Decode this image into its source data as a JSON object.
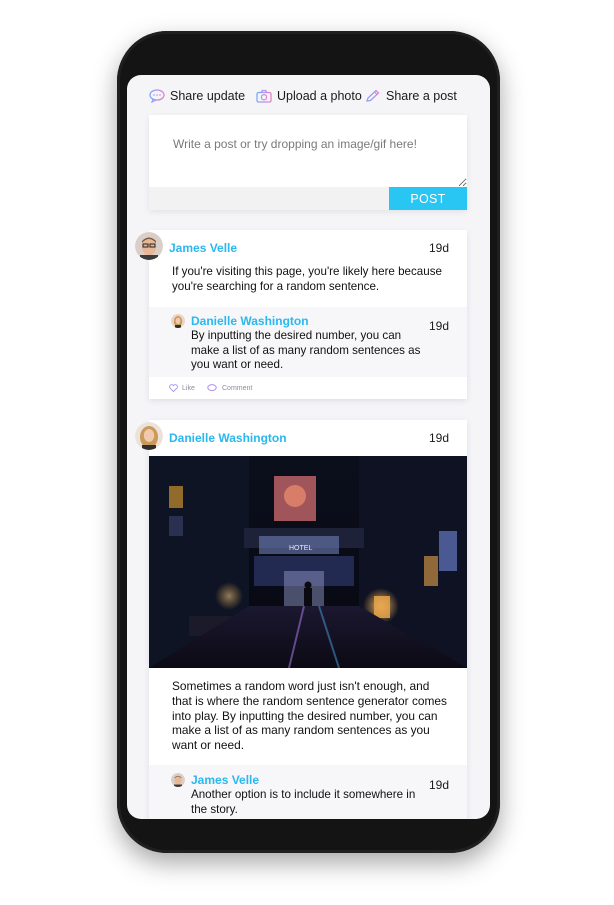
{
  "share_bar": {
    "share_update": "Share update",
    "upload_photo": "Upload a photo",
    "share_post": "Share a post"
  },
  "composer": {
    "placeholder": "Write a post or try dropping an image/gif here!",
    "post_label": "POST"
  },
  "feed": [
    {
      "author": "James Velle",
      "time": "19d",
      "text_line1": "If you're visiting this page, you're likely here because",
      "text_line2": "you're searching for a random sentence.",
      "reply": {
        "author": "Danielle Washington",
        "time": "19d",
        "line1": "By inputting the desired number, you can",
        "line2": "make a list of as many random sentences as",
        "line3": "you want or need."
      },
      "like_label": "Like",
      "comment_label": "Comment"
    },
    {
      "author": "Danielle Washington",
      "time": "19d",
      "text_line1": "Sometimes a random word just isn't enough, and",
      "text_line2": "that is where the random sentence generator comes",
      "text_line3": "into play. By inputting the desired number, you can",
      "text_line4": "make a list of as many random sentences as you",
      "text_line5": "want or need.",
      "reply": {
        "author": "James Velle",
        "time": "19d",
        "line1": "Another option is to include it somewhere in",
        "line2": "the story."
      }
    }
  ],
  "colors": {
    "accent": "#29c6f3",
    "author": "#29b8ef",
    "icon_pink": "#e77fd0",
    "icon_blue": "#7aa9ff"
  }
}
